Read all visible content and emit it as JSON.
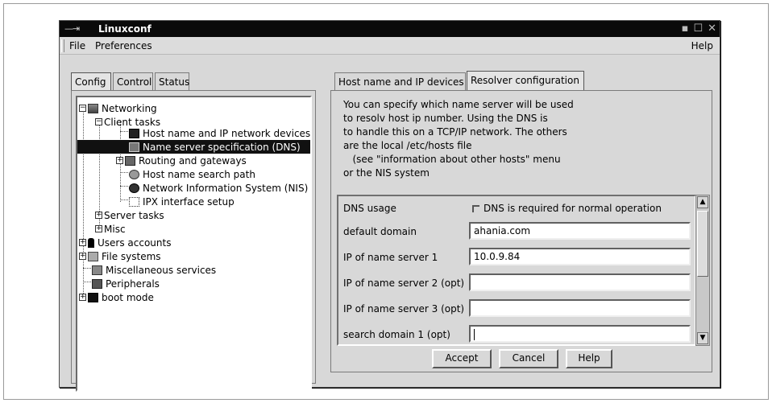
{
  "window": {
    "title": "Linuxconf"
  },
  "menu": {
    "file": "File",
    "preferences": "Preferences",
    "help": "Help"
  },
  "left_tabs": [
    "Config",
    "Control",
    "Status"
  ],
  "tree": [
    {
      "label": "Networking",
      "level": 0
    },
    {
      "label": "Client tasks",
      "level": 1
    },
    {
      "label": "Host name and IP network devices",
      "level": 2
    },
    {
      "label": "Name server specification (DNS)",
      "level": 2,
      "selected": true
    },
    {
      "label": "Routing and gateways",
      "level": 2
    },
    {
      "label": "Host name search path",
      "level": 2
    },
    {
      "label": "Network Information System (NIS)",
      "level": 2
    },
    {
      "label": "IPX interface setup",
      "level": 2
    },
    {
      "label": "Server tasks",
      "level": 1
    },
    {
      "label": "Misc",
      "level": 1
    },
    {
      "label": "Users accounts",
      "level": 0
    },
    {
      "label": "File systems",
      "level": 0
    },
    {
      "label": "Miscellaneous services",
      "level": 0
    },
    {
      "label": "Peripherals",
      "level": 0
    },
    {
      "label": "boot mode",
      "level": 0
    }
  ],
  "right_tabs": [
    "Host name and IP devices",
    "Resolver configuration"
  ],
  "info_lines": [
    "You can specify which name server will be used",
    "to resolv host ip number. Using the DNS is",
    "to handle this on a TCP/IP network. The others",
    "are the local /etc/hosts file",
    "   (see \"information about other hosts\" menu",
    "or the NIS system"
  ],
  "form": {
    "dns_usage_label": "DNS usage",
    "dns_usage_checkbox": "DNS is required for normal operation",
    "fields": [
      {
        "label": "default domain",
        "value": "ahania.com"
      },
      {
        "label": "IP of name server 1",
        "value": "10.0.9.84"
      },
      {
        "label": "IP of name server 2 (opt)",
        "value": ""
      },
      {
        "label": "IP of name server 3 (opt)",
        "value": ""
      },
      {
        "label": "search domain 1 (opt)",
        "value": ""
      }
    ]
  },
  "buttons": {
    "accept": "Accept",
    "cancel": "Cancel",
    "help": "Help"
  }
}
